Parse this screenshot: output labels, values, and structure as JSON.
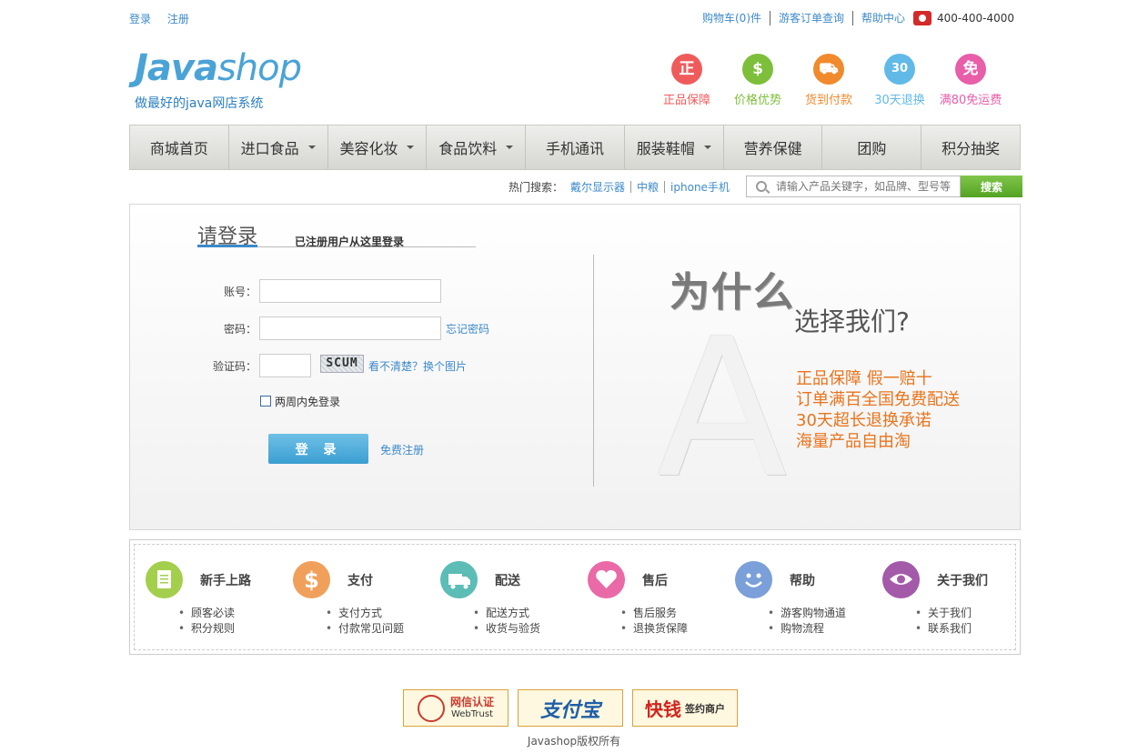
{
  "topbar": {
    "login": "登录",
    "register": "注册",
    "cart": "购物车(0)件",
    "guest_order": "游客订单查询",
    "help_center": "帮助中心",
    "phone": "400-400-4000"
  },
  "logo": {
    "brand_a": "Java",
    "brand_b": "shop",
    "tagline": "做最好的java网店系统"
  },
  "features": [
    {
      "label": "正品保障",
      "glyph": "正",
      "color": "#ef5b5b",
      "icon": "quality-icon"
    },
    {
      "label": "价格优势",
      "glyph": "$",
      "color": "#7dbf3a",
      "icon": "price-tag-icon"
    },
    {
      "label": "货到付款",
      "glyph": "⛟",
      "color": "#f08a2c",
      "icon": "delivery-truck-icon"
    },
    {
      "label": "30天退换",
      "glyph": "30",
      "color": "#61b9e8",
      "icon": "clock-30-icon"
    },
    {
      "label": "满80免运费",
      "glyph": "免",
      "color": "#e85ea8",
      "icon": "free-shipping-icon"
    }
  ],
  "nav": [
    {
      "label": "商城首页",
      "dropdown": false
    },
    {
      "label": "进口食品",
      "dropdown": true
    },
    {
      "label": "美容化妆",
      "dropdown": true
    },
    {
      "label": "食品饮料",
      "dropdown": true
    },
    {
      "label": "手机通讯",
      "dropdown": false
    },
    {
      "label": "服装鞋帽",
      "dropdown": true
    },
    {
      "label": "营养保健",
      "dropdown": false
    },
    {
      "label": "团购",
      "dropdown": false
    },
    {
      "label": "积分抽奖",
      "dropdown": false
    }
  ],
  "hot_search": {
    "label": "热门搜索：",
    "keywords": [
      "戴尔显示器",
      "中粮",
      "iphone手机"
    ]
  },
  "search": {
    "placeholder": "请输入产品关键字，如品牌、型号等",
    "button": "搜索"
  },
  "login": {
    "title": "请登录",
    "subtitle": "已注册用户从这里登录",
    "account_label": "账号：",
    "password_label": "密码：",
    "forgot": "忘记密码",
    "captcha_label": "验证码：",
    "captcha_text": "SCUM",
    "refresh_captcha": "看不清楚？换个图片",
    "remember": "两周内免登录",
    "submit": "登 录",
    "free_register": "免费注册"
  },
  "why": {
    "heading": "为什么",
    "sub": "选择我们?",
    "big_letter": "A",
    "benefits": [
      "正品保障 假一赔十",
      "订单满百全国免费配送",
      "30天超长退换承诺",
      "海量产品自由淘"
    ]
  },
  "help": [
    {
      "title": "新手上路",
      "color": "#a3cf4c",
      "icon": "document-icon",
      "links": [
        "顾客必读",
        "积分规则"
      ]
    },
    {
      "title": "支付",
      "color": "#f0a05b",
      "icon": "dollar-icon",
      "links": [
        "支付方式",
        "付款常见问题"
      ]
    },
    {
      "title": "配送",
      "color": "#5bbdb5",
      "icon": "truck-icon",
      "links": [
        "配送方式",
        "收货与验货"
      ]
    },
    {
      "title": "售后",
      "color": "#e96aa7",
      "icon": "heart-icon",
      "links": [
        "售后服务",
        "退换货保障"
      ]
    },
    {
      "title": "帮助",
      "color": "#7b9fd8",
      "icon": "smiley-icon",
      "links": [
        "游客购物通道",
        "购物流程"
      ]
    },
    {
      "title": "关于我们",
      "color": "#a35aa8",
      "icon": "eye-icon",
      "links": [
        "关于我们",
        "联系我们"
      ]
    }
  ],
  "footer": {
    "badge1_title": "网信认证",
    "badge1_sub": "WebTrust",
    "badge2": "支付宝",
    "badge3_a": "快钱",
    "badge3_b": "签约商户",
    "copyright": "Javashop版权所有"
  }
}
